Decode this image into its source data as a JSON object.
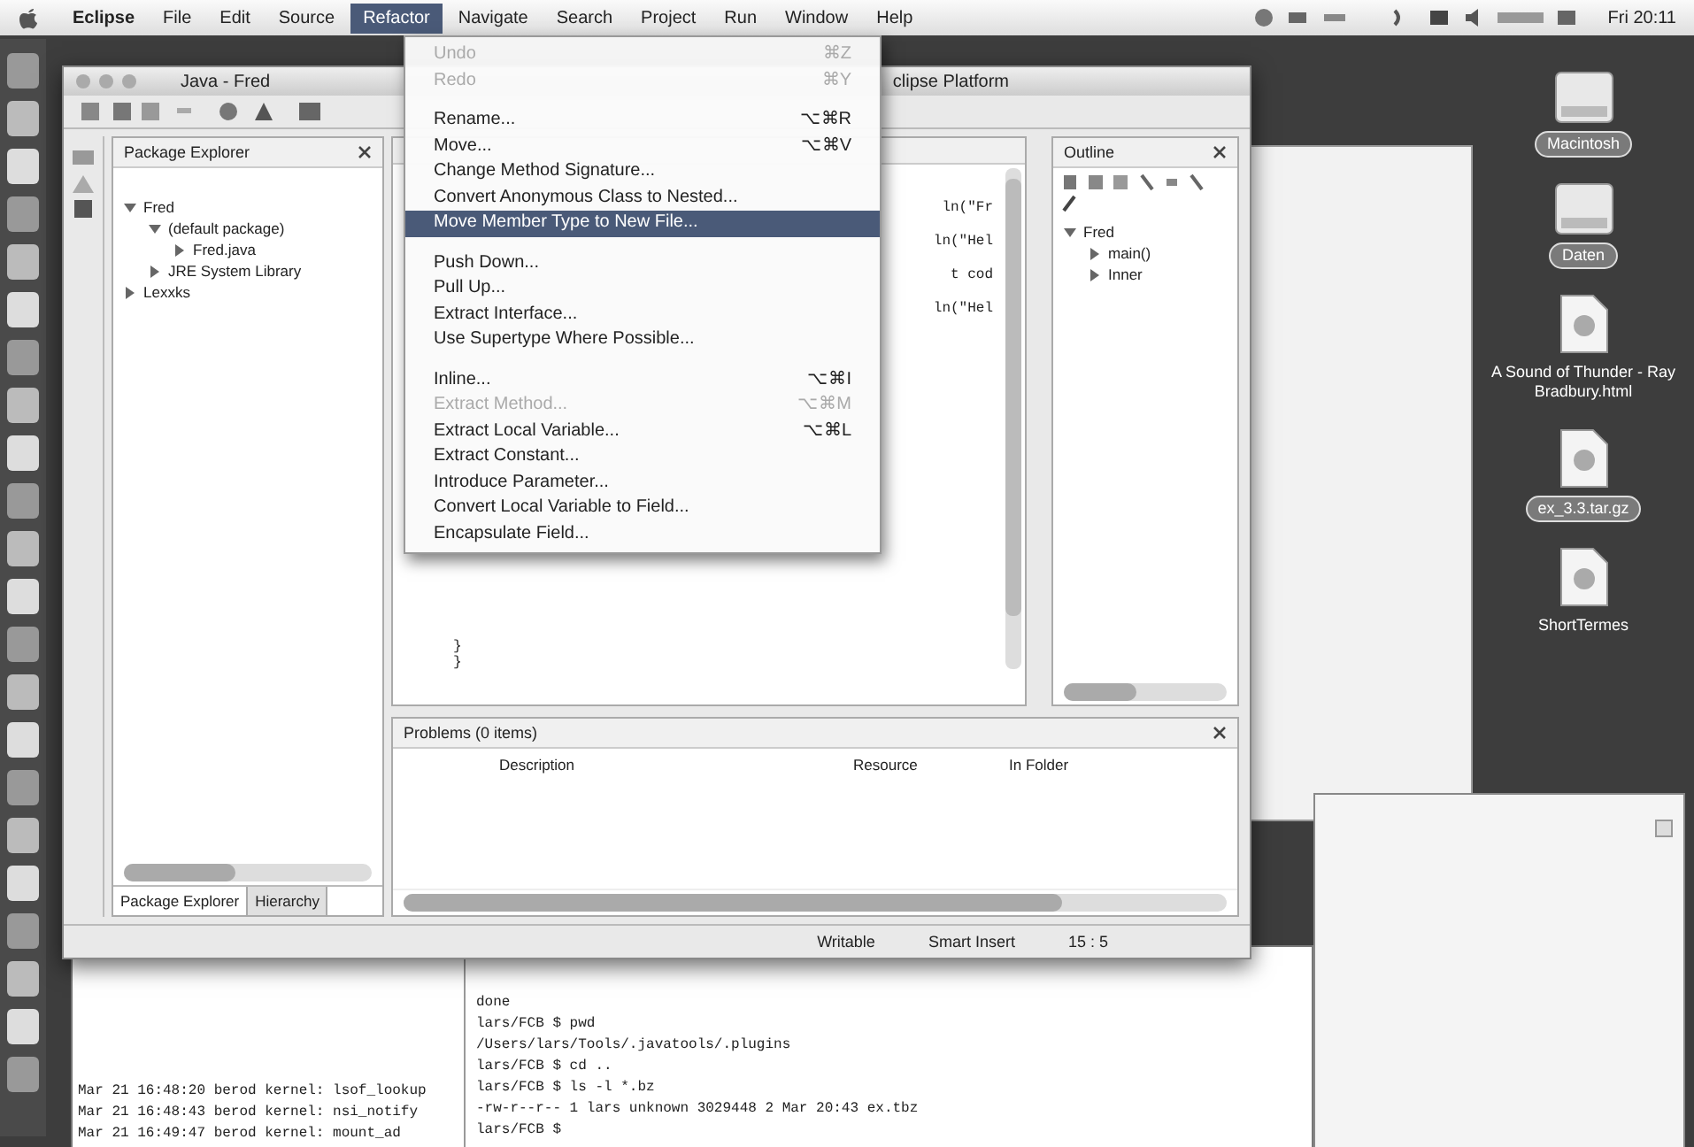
{
  "menu_bar": {
    "items": [
      {
        "label": "Eclipse",
        "selected": false
      },
      {
        "label": "File",
        "selected": false
      },
      {
        "label": "Edit",
        "selected": false
      },
      {
        "label": "Source",
        "selected": false
      },
      {
        "label": "Refactor",
        "selected": true
      },
      {
        "label": "Navigate",
        "selected": false
      },
      {
        "label": "Search",
        "selected": false
      },
      {
        "label": "Project",
        "selected": false
      },
      {
        "label": "Run",
        "selected": false
      },
      {
        "label": "Window",
        "selected": false
      },
      {
        "label": "Help",
        "selected": false
      }
    ],
    "clock": "Fri 20:11"
  },
  "refactor_menu": {
    "items": [
      {
        "kind": "item",
        "label": "Undo",
        "shortcut": "⌘Z",
        "disabled": true,
        "selected": false
      },
      {
        "kind": "item",
        "label": "Redo",
        "shortcut": "⌘Y",
        "disabled": true,
        "selected": false
      },
      {
        "kind": "separator"
      },
      {
        "kind": "item",
        "label": "Rename...",
        "shortcut": "⌥⌘R",
        "disabled": false,
        "selected": false
      },
      {
        "kind": "item",
        "label": "Move...",
        "shortcut": "⌥⌘V",
        "disabled": false,
        "selected": false
      },
      {
        "kind": "item",
        "label": "Change Method Signature...",
        "disabled": false,
        "selected": false
      },
      {
        "kind": "item",
        "label": "Convert Anonymous Class to Nested...",
        "disabled": false,
        "selected": false
      },
      {
        "kind": "item",
        "label": "Move Member Type to New File...",
        "disabled": false,
        "selected": true
      },
      {
        "kind": "separator"
      },
      {
        "kind": "item",
        "label": "Push Down...",
        "disabled": false,
        "selected": false
      },
      {
        "kind": "item",
        "label": "Pull Up...",
        "disabled": false,
        "selected": false
      },
      {
        "kind": "item",
        "label": "Extract Interface...",
        "disabled": false,
        "selected": false
      },
      {
        "kind": "item",
        "label": "Use Supertype Where Possible...",
        "disabled": false,
        "selected": false
      },
      {
        "kind": "separator"
      },
      {
        "kind": "item",
        "label": "Inline...",
        "shortcut": "⌥⌘I",
        "disabled": false,
        "selected": false
      },
      {
        "kind": "item",
        "label": "Extract Method...",
        "shortcut": "⌥⌘M",
        "disabled": true,
        "selected": false
      },
      {
        "kind": "item",
        "label": "Extract Local Variable...",
        "shortcut": "⌥⌘L",
        "disabled": false,
        "selected": false
      },
      {
        "kind": "item",
        "label": "Extract Constant...",
        "disabled": false,
        "selected": false
      },
      {
        "kind": "item",
        "label": "Introduce Parameter...",
        "disabled": false,
        "selected": false
      },
      {
        "kind": "item",
        "label": "Convert Local Variable to Field...",
        "disabled": false,
        "selected": false
      },
      {
        "kind": "item",
        "label": "Encapsulate Field...",
        "disabled": false,
        "selected": false
      }
    ]
  },
  "eclipse_window": {
    "title_left": "Java - Fred",
    "title_right": "clipse Platform"
  },
  "package_explorer": {
    "title": "Package Explorer",
    "tree": [
      {
        "label": "Fred",
        "expanded": true,
        "children": [
          {
            "label": "(default package)",
            "expanded": true,
            "children": [
              {
                "label": "Fred.java",
                "expanded": false
              }
            ]
          },
          {
            "label": "JRE System Library",
            "expanded": false
          }
        ]
      },
      {
        "label": "Lexxks",
        "expanded": false
      }
    ],
    "tabs": [
      {
        "label": "Package Explorer",
        "selected": true
      },
      {
        "label": "Hierarchy",
        "selected": false
      }
    ]
  },
  "editor": {
    "code_fragments": [
      "ln(\"Fr",
      "ln(\"Hel",
      "t cod",
      "ln(\"Hel"
    ],
    "code_lines": [
      "}",
      "}"
    ]
  },
  "outline": {
    "title": "Outline",
    "tree": [
      {
        "label": "Fred",
        "expanded": true,
        "children": [
          {
            "label": "main()",
            "expanded": false
          },
          {
            "label": "Inner",
            "expanded": false
          }
        ]
      }
    ]
  },
  "problems": {
    "title": "Problems (0 items)",
    "columns": [
      "Description",
      "Resource",
      "In Folder"
    ]
  },
  "status_bar": {
    "items": [
      "Writable",
      "Smart Insert",
      "15 : 5"
    ]
  },
  "desktop_icons": [
    {
      "label": "Macintosh",
      "kind": "disk",
      "selected": true
    },
    {
      "label": "Daten",
      "kind": "disk",
      "selected": true
    },
    {
      "label": "A Sound of Thunder - Ray Bradbury.html",
      "kind": "file",
      "selected": false
    },
    {
      "label": "ex_3.3.tar.gz",
      "kind": "file",
      "selected": true
    },
    {
      "label": "ShortTermes",
      "kind": "file",
      "selected": false
    }
  ],
  "terminal": {
    "log_lines": [
      "Mar 21 16:48:20 berod kernel: lsof_lookup",
      "Mar 21 16:48:43 berod kernel: nsi_notify",
      "Mar 21 16:49:47 berod kernel: mount_ad"
    ],
    "lines": [
      "done",
      "lars/FCB $ pwd",
      "/Users/lars/Tools/.javatools/.plugins",
      "lars/FCB $ cd ..",
      "lars/FCB $ ls -l *.bz",
      "-rw-r--r--  1 lars  unknown  3029448 2 Mar 20:43 ex.tbz",
      "lars/FCB $"
    ]
  }
}
